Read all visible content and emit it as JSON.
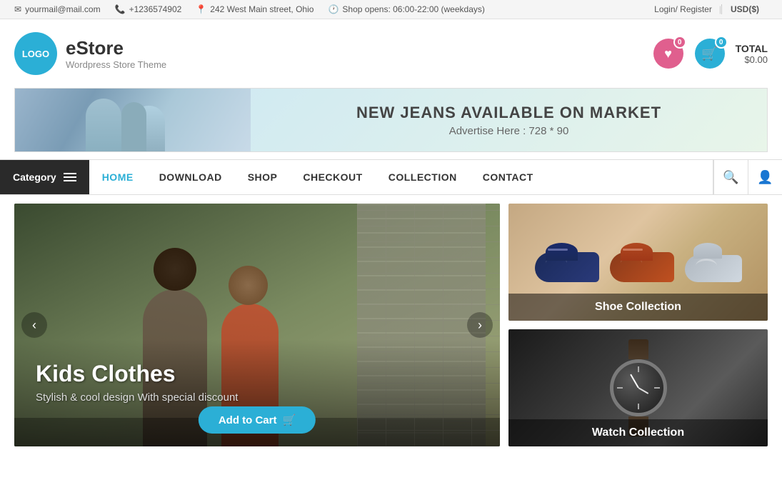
{
  "topbar": {
    "email": "yourmail@mail.com",
    "phone": "+1236574902",
    "address": "242 West Main street, Ohio",
    "hours": "Shop opens: 06:00-22:00 (weekdays)",
    "login": "Login/ Register",
    "currency": "USD($)"
  },
  "header": {
    "logo_text": "LOGO",
    "brand_name": "eStore",
    "brand_tagline": "Wordpress Store Theme",
    "wishlist_count": "0",
    "cart_count": "0",
    "total_label": "TOTAL",
    "total_amount": "$0.00"
  },
  "banner": {
    "headline": "NEW JEANS AVAILABLE ON MARKET",
    "subtext": "Advertise Here : 728 * 90"
  },
  "nav": {
    "category_label": "Category",
    "items": [
      {
        "label": "HOME",
        "active": true
      },
      {
        "label": "DOWNLOAD",
        "active": false
      },
      {
        "label": "SHOP",
        "active": false
      },
      {
        "label": "CHECKOUT",
        "active": false
      },
      {
        "label": "COLLECTION",
        "active": false
      },
      {
        "label": "CONTACT",
        "active": false
      }
    ]
  },
  "slider": {
    "title": "Kids Clothes",
    "subtitle": "Stylish & cool design With special discount",
    "cta_label": "Add to Cart",
    "prev_label": "‹",
    "next_label": "›"
  },
  "panels": [
    {
      "label": "Shoe Collection"
    },
    {
      "label": "Watch Collection"
    }
  ]
}
